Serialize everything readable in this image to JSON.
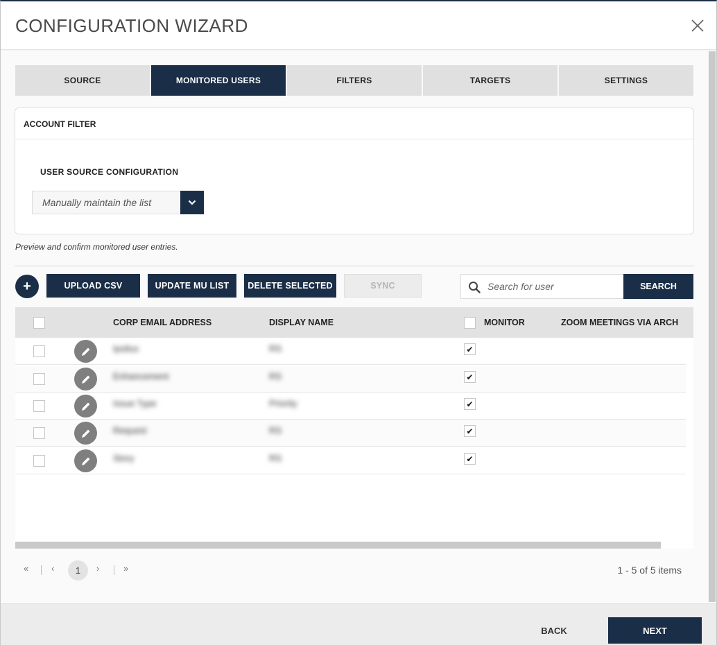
{
  "dialog": {
    "title": "CONFIGURATION WIZARD"
  },
  "tabs": [
    {
      "label": "SOURCE",
      "active": false
    },
    {
      "label": "MONITORED USERS",
      "active": true
    },
    {
      "label": "FILTERS",
      "active": false
    },
    {
      "label": "TARGETS",
      "active": false
    },
    {
      "label": "SETTINGS",
      "active": false
    }
  ],
  "account_filter": {
    "title": "ACCOUNT FILTER",
    "user_source_label": "USER SOURCE CONFIGURATION",
    "user_source_value": "Manually maintain the list"
  },
  "hint": "Preview and confirm monitored user entries.",
  "toolbar": {
    "add_label": "+",
    "upload_csv": "UPLOAD CSV",
    "update_mu_list": "UPDATE MU LIST",
    "delete_selected": "DELETE SELECTED",
    "sync": "SYNC",
    "search_placeholder": "Search for user",
    "search_button": "SEARCH"
  },
  "grid": {
    "columns": [
      "CORP EMAIL ADDRESS",
      "DISPLAY NAME",
      "MONITOR",
      "ZOOM MEETINGS VIA ARCH"
    ],
    "rows": [
      {
        "email": "Ipsilus",
        "display_name": "RS",
        "monitor": true
      },
      {
        "email": "Enhancement",
        "display_name": "RS",
        "monitor": true
      },
      {
        "email": "Issue Type",
        "display_name": "Priority",
        "monitor": true
      },
      {
        "email": "Request",
        "display_name": "RS",
        "monitor": true
      },
      {
        "email": "Story",
        "display_name": "RS",
        "monitor": true
      }
    ],
    "check_mark": "✔"
  },
  "pager": {
    "first": "«",
    "prev": "‹",
    "current": "1",
    "next": "›",
    "last": "»",
    "info": "1 - 5 of 5 items"
  },
  "footer": {
    "back": "BACK",
    "next": "NEXT"
  },
  "colors": {
    "primary": "#1b2e48",
    "tab_inactive": "#e0e0e0",
    "footer_bg": "#ececec"
  },
  "icons": {
    "close": "close-icon",
    "chevron": "chevron-down-icon",
    "search": "search-icon",
    "edit": "pencil-icon"
  }
}
